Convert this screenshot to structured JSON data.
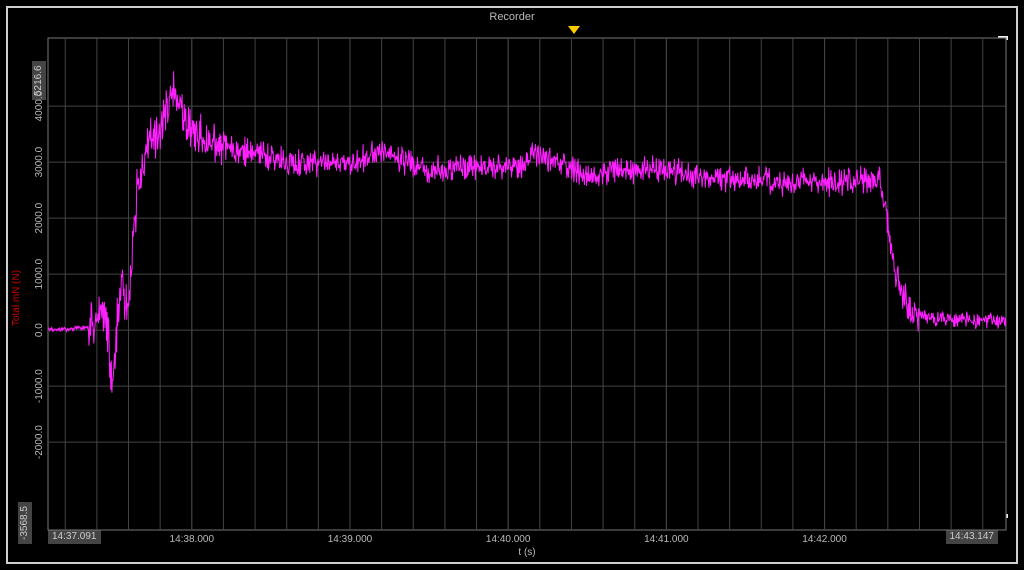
{
  "title": "Recorder",
  "axis": {
    "xlabel": "t (s)",
    "ylabel": "Total mN (N)",
    "y_range_top_label": "5216.6",
    "y_range_bottom_label": "-3568.5",
    "x_range_left_label": "14:37.091",
    "x_range_right_label": "14:43.147"
  },
  "y_ticks": [
    {
      "v": -2000,
      "label": "-2000.0"
    },
    {
      "v": -1000,
      "label": "-1000.0"
    },
    {
      "v": 0,
      "label": "0.0"
    },
    {
      "v": 1000,
      "label": "1000.0"
    },
    {
      "v": 2000,
      "label": "2000.0"
    },
    {
      "v": 3000,
      "label": "3000.0"
    },
    {
      "v": 4000,
      "label": "4000.0"
    }
  ],
  "x_ticks": [
    {
      "v": 38,
      "label": "14:38.000"
    },
    {
      "v": 39,
      "label": "14:39.000"
    },
    {
      "v": 40,
      "label": "14:40.000"
    },
    {
      "v": 41,
      "label": "14:41.000"
    },
    {
      "v": 42,
      "label": "14:42.000"
    }
  ],
  "trace_color": "#ff20ff",
  "chart_data": {
    "type": "line",
    "title": "Recorder",
    "xlabel": "t (s)",
    "ylabel": "Total mN (N)",
    "ylim": [
      -3568.5,
      5216.6
    ],
    "xlim": [
      37.091,
      43.147
    ],
    "series": [
      {
        "name": "Total mN (N)",
        "color": "#ff20ff",
        "baseline": [
          {
            "x": 37.091,
            "y": 0
          },
          {
            "x": 37.35,
            "y": 50
          },
          {
            "x": 37.45,
            "y": 400
          },
          {
            "x": 37.5,
            "y": -900
          },
          {
            "x": 37.55,
            "y": 900
          },
          {
            "x": 37.6,
            "y": 300
          },
          {
            "x": 37.65,
            "y": 2300
          },
          {
            "x": 37.72,
            "y": 3300
          },
          {
            "x": 37.8,
            "y": 3600
          },
          {
            "x": 37.88,
            "y": 4300
          },
          {
            "x": 38.0,
            "y": 3500
          },
          {
            "x": 38.3,
            "y": 3200
          },
          {
            "x": 38.6,
            "y": 3000
          },
          {
            "x": 39.0,
            "y": 2950
          },
          {
            "x": 39.2,
            "y": 3200
          },
          {
            "x": 39.5,
            "y": 2850
          },
          {
            "x": 39.8,
            "y": 2900
          },
          {
            "x": 40.1,
            "y": 2900
          },
          {
            "x": 40.15,
            "y": 3200
          },
          {
            "x": 40.5,
            "y": 2750
          },
          {
            "x": 40.9,
            "y": 2900
          },
          {
            "x": 41.3,
            "y": 2700
          },
          {
            "x": 41.8,
            "y": 2650
          },
          {
            "x": 42.2,
            "y": 2650
          },
          {
            "x": 42.35,
            "y": 2700
          },
          {
            "x": 42.45,
            "y": 1000
          },
          {
            "x": 42.55,
            "y": 300
          },
          {
            "x": 42.7,
            "y": 200
          },
          {
            "x": 43.147,
            "y": 150
          }
        ],
        "noise_amplitude": 350
      }
    ]
  }
}
